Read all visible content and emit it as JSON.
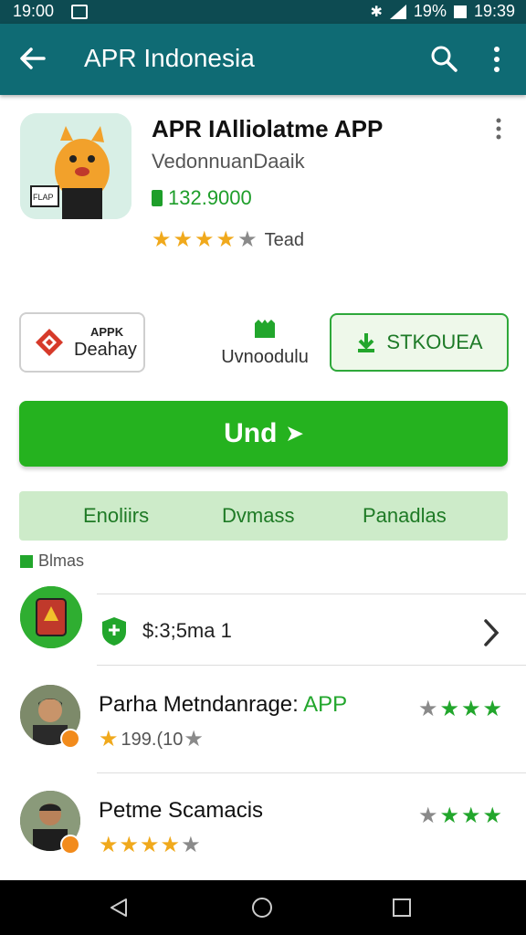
{
  "status_bar": {
    "time_left": "19:00",
    "battery": "19%",
    "time_right": "19:39"
  },
  "app_bar": {
    "title": "APR Indonesia"
  },
  "app": {
    "name": "APR IAlliolatme APP",
    "developer": "VedonnuanDaaik",
    "price": "132.9000",
    "rating_label": "Tead",
    "rating_stars": 4
  },
  "actions": {
    "apk_line1": "APPK",
    "apk_line2": "Deahay",
    "download_label": "Uvnoodulu",
    "outline_button": "STKOUEA",
    "primary_button": "Und"
  },
  "tabs": [
    "Enoliirs",
    "Dvmass",
    "Panadlas"
  ],
  "section": {
    "label": "Blmas"
  },
  "item": {
    "text": "$:3;5ma 1"
  },
  "reviews": [
    {
      "name": "Parha Metndanrage:",
      "name_highlight": "APP",
      "sub": "199.(10",
      "stars": 1,
      "rating": 4
    },
    {
      "name": "Petme Scamacis",
      "name_highlight": "",
      "sub": "",
      "stars": 4,
      "rating": 4
    }
  ],
  "colors": {
    "appbar": "#0f6b74",
    "statusbar": "#0d4b52",
    "primary": "#25b21f",
    "accent_green": "#22a62c",
    "star_gold": "#f0a91c"
  },
  "icons": [
    "back-arrow-icon",
    "search-icon",
    "more-vert-icon",
    "price-tag-icon",
    "download-icon",
    "shield-icon",
    "chevron-right-icon",
    "nav-back-icon",
    "nav-home-icon",
    "nav-recents-icon"
  ]
}
